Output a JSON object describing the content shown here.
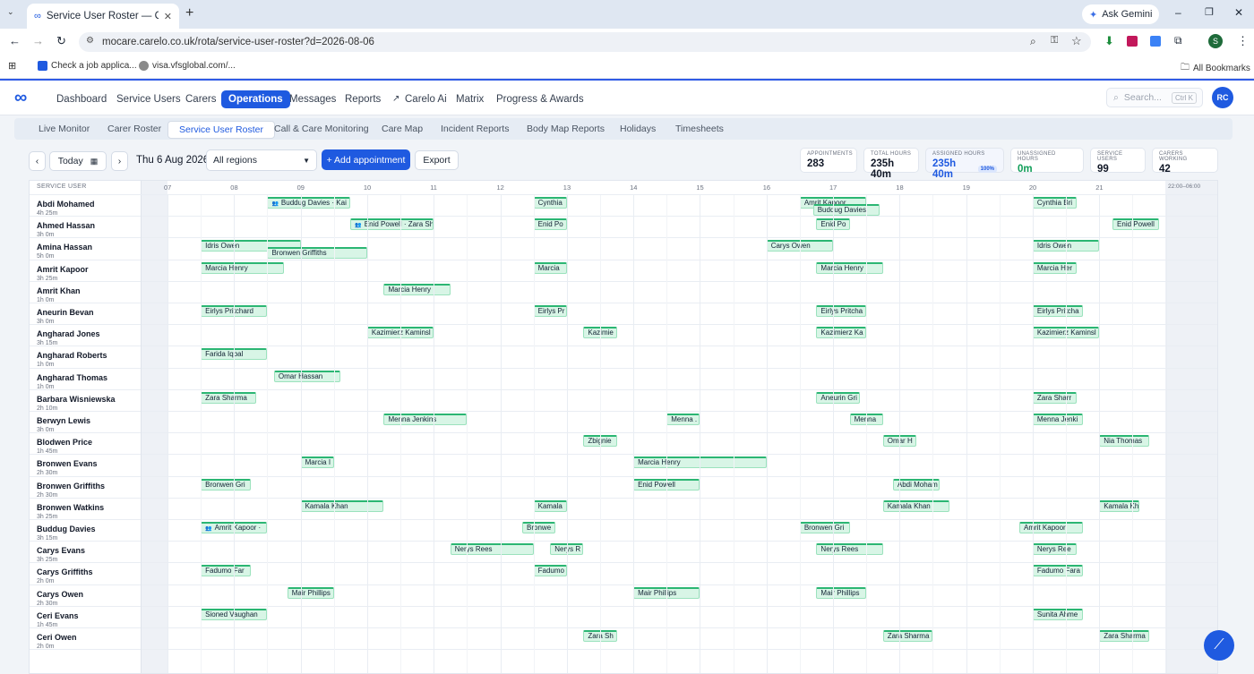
{
  "browser": {
    "tab_title": "Service User Roster — Carelo",
    "url": "mocare.carelo.co.uk/rota/service-user-roster?d=2026-08-06",
    "ask_gemini": "Ask Gemini",
    "profile_initial": "S",
    "bookmarks": [
      "Check a job applica...",
      "visa.vfsglobal.com/..."
    ],
    "all_bookmarks": "All Bookmarks"
  },
  "nav": {
    "items": [
      "Dashboard",
      "Service Users",
      "Carers",
      "Operations",
      "Messages",
      "Reports",
      "Carelo Ai",
      "Matrix",
      "Progress & Awards"
    ],
    "active": "Operations",
    "search_placeholder": "Search...",
    "search_shortcut": "Ctrl K",
    "avatar": "RC"
  },
  "subtabs": {
    "items": [
      "Live Monitor",
      "Carer Roster",
      "Service User Roster",
      "Call & Care Monitoring",
      "Care Map",
      "Incident Reports",
      "Body Map Reports",
      "Holidays",
      "Timesheets"
    ],
    "active": "Service User Roster"
  },
  "toolbar": {
    "today": "Today",
    "date": "Thu 6 Aug 2026",
    "region": "All regions",
    "add": "+ Add appointment",
    "export": "Export"
  },
  "stats": [
    {
      "k": "Appointments",
      "v": "283"
    },
    {
      "k": "Total hours",
      "v": "235h 40m"
    },
    {
      "k": "Assigned hours",
      "v": "235h 40m",
      "badge": "100%"
    },
    {
      "k": "Unassigned hours",
      "v": "0m"
    },
    {
      "k": "Service users",
      "v": "99"
    },
    {
      "k": "Carers working",
      "v": "42"
    }
  ],
  "grid": {
    "header": "SERVICE USER",
    "hours": [
      "07",
      "08",
      "09",
      "10",
      "11",
      "12",
      "13",
      "14",
      "15",
      "16",
      "17",
      "18",
      "19",
      "20",
      "21"
    ],
    "night": "22:00–06:00"
  },
  "rows": [
    {
      "name": "Abdi Mohamed",
      "dur": "4h 25m",
      "appts": [
        {
          "s": 8.5,
          "e": 9.75,
          "t": "Buddug Davies · Kai",
          "g": true
        },
        {
          "s": 12.5,
          "e": 13,
          "t": "Cynthia"
        },
        {
          "s": 16.5,
          "e": 17.5,
          "t": "Amrit Kapoor"
        },
        {
          "s": 16.7,
          "e": 17.7,
          "t": "Buddug Davies",
          "l": 2
        },
        {
          "s": 20,
          "e": 20.66,
          "t": "Cynthia Bri"
        }
      ]
    },
    {
      "name": "Ahmed Hassan",
      "dur": "3h 0m",
      "appts": [
        {
          "s": 9.75,
          "e": 11,
          "t": "Enid Powell · Zara Sh",
          "g": true
        },
        {
          "s": 12.5,
          "e": 13,
          "t": "Enid Po"
        },
        {
          "s": 16.75,
          "e": 17.25,
          "t": "Enid Po"
        },
        {
          "s": 21.2,
          "e": 21.9,
          "t": "Enid Powell"
        }
      ]
    },
    {
      "name": "Amina Hassan",
      "dur": "5h 0m",
      "appts": [
        {
          "s": 7.5,
          "e": 9,
          "t": "Idris Owen"
        },
        {
          "s": 8.5,
          "e": 10,
          "t": "Bronwen Griffiths",
          "l": 2
        },
        {
          "s": 16,
          "e": 17,
          "t": "Carys Owen"
        },
        {
          "s": 20,
          "e": 21,
          "t": "Idris Owen"
        }
      ]
    },
    {
      "name": "Amrit Kapoor",
      "dur": "3h 25m",
      "appts": [
        {
          "s": 7.5,
          "e": 8.75,
          "t": "Marcia Henry"
        },
        {
          "s": 12.5,
          "e": 13,
          "t": "Marcia"
        },
        {
          "s": 16.75,
          "e": 17.75,
          "t": "Marcia Henry"
        },
        {
          "s": 20,
          "e": 20.66,
          "t": "Marcia Her"
        }
      ]
    },
    {
      "name": "Amrit Khan",
      "dur": "1h 0m",
      "appts": [
        {
          "s": 10.25,
          "e": 11.25,
          "t": "Marcia Henry"
        }
      ]
    },
    {
      "name": "Aneurin Bevan",
      "dur": "3h 0m",
      "appts": [
        {
          "s": 7.5,
          "e": 8.5,
          "t": "Eirlys Pritchard"
        },
        {
          "s": 12.5,
          "e": 13,
          "t": "Eirlys Pr"
        },
        {
          "s": 16.75,
          "e": 17.5,
          "t": "Eirlys Pritcha"
        },
        {
          "s": 20,
          "e": 20.75,
          "t": "Eirlys Pritcha"
        }
      ]
    },
    {
      "name": "Angharad Jones",
      "dur": "3h 15m",
      "appts": [
        {
          "s": 10,
          "e": 11,
          "t": "Kazimierz Kaminsl"
        },
        {
          "s": 13.25,
          "e": 13.75,
          "t": "Kazimie"
        },
        {
          "s": 16.75,
          "e": 17.5,
          "t": "Kazimierz Ka"
        },
        {
          "s": 20,
          "e": 21,
          "t": "Kazimierz Kaminsl"
        }
      ]
    },
    {
      "name": "Angharad Roberts",
      "dur": "1h 0m",
      "appts": [
        {
          "s": 7.5,
          "e": 8.5,
          "t": "Farida Iqbal"
        }
      ]
    },
    {
      "name": "Angharad Thomas",
      "dur": "1h 0m",
      "appts": [
        {
          "s": 8.6,
          "e": 9.6,
          "t": "Omar Hassan"
        }
      ]
    },
    {
      "name": "Barbara Wisniewska",
      "dur": "2h 10m",
      "appts": [
        {
          "s": 7.5,
          "e": 8.33,
          "t": "Zara Sharma"
        },
        {
          "s": 16.75,
          "e": 17.4,
          "t": "Aneurin Gri"
        },
        {
          "s": 20,
          "e": 20.66,
          "t": "Zara Sharr"
        }
      ]
    },
    {
      "name": "Berwyn Lewis",
      "dur": "3h 0m",
      "appts": [
        {
          "s": 10.25,
          "e": 11.5,
          "t": "Menna Jenkins"
        },
        {
          "s": 14.5,
          "e": 15,
          "t": "Menna ."
        },
        {
          "s": 17.25,
          "e": 17.75,
          "t": "Menna"
        },
        {
          "s": 20,
          "e": 20.75,
          "t": "Menna Jenki"
        }
      ]
    },
    {
      "name": "Blodwen Price",
      "dur": "1h 45m",
      "appts": [
        {
          "s": 13.25,
          "e": 13.75,
          "t": "Zbignie"
        },
        {
          "s": 17.75,
          "e": 18.25,
          "t": "Omar H"
        },
        {
          "s": 21,
          "e": 21.75,
          "t": "Nia Thomas"
        }
      ]
    },
    {
      "name": "Bronwen Evans",
      "dur": "2h 30m",
      "appts": [
        {
          "s": 9,
          "e": 9.5,
          "t": "Marcia I"
        },
        {
          "s": 14,
          "e": 16,
          "t": "Marcia Henry"
        }
      ]
    },
    {
      "name": "Bronwen Griffiths",
      "dur": "2h 30m",
      "appts": [
        {
          "s": 7.5,
          "e": 8.25,
          "t": "Bronwen Gri"
        },
        {
          "s": 14,
          "e": 15,
          "t": "Enid Powell"
        },
        {
          "s": 17.9,
          "e": 18.6,
          "t": "Abdi Moham"
        }
      ]
    },
    {
      "name": "Bronwen Watkins",
      "dur": "3h 25m",
      "appts": [
        {
          "s": 9,
          "e": 10.25,
          "t": "Kamala Khan"
        },
        {
          "s": 12.5,
          "e": 13,
          "t": "Kamala"
        },
        {
          "s": 17.75,
          "e": 18.75,
          "t": "Kamala Khan"
        },
        {
          "s": 21,
          "e": 21.6,
          "t": "Kamala Kh"
        }
      ]
    },
    {
      "name": "Buddug Davies",
      "dur": "3h 15m",
      "appts": [
        {
          "s": 7.5,
          "e": 8.5,
          "t": "Amrit Kapoor ·",
          "g": true
        },
        {
          "s": 12.33,
          "e": 12.83,
          "t": "Bronwe"
        },
        {
          "s": 16.5,
          "e": 17.25,
          "t": "Bronwen Gri"
        },
        {
          "s": 19.8,
          "e": 20.75,
          "t": "Amrit Kapoor"
        }
      ]
    },
    {
      "name": "Carys Evans",
      "dur": "3h 25m",
      "appts": [
        {
          "s": 11.25,
          "e": 12.5,
          "t": "Nerys Rees"
        },
        {
          "s": 12.75,
          "e": 13.25,
          "t": "Nerys R"
        },
        {
          "s": 16.75,
          "e": 17.75,
          "t": "Nerys Rees"
        },
        {
          "s": 20,
          "e": 20.66,
          "t": "Nerys Ree"
        }
      ]
    },
    {
      "name": "Carys Griffiths",
      "dur": "2h 0m",
      "appts": [
        {
          "s": 7.5,
          "e": 8.25,
          "t": "Fadumo Far"
        },
        {
          "s": 12.5,
          "e": 13,
          "t": "Fadumo"
        },
        {
          "s": 20,
          "e": 20.75,
          "t": "Fadumo Fara"
        }
      ]
    },
    {
      "name": "Carys Owen",
      "dur": "2h 30m",
      "appts": [
        {
          "s": 8.8,
          "e": 9.5,
          "t": "Mair Phillips"
        },
        {
          "s": 14,
          "e": 15,
          "t": "Mair Phillips"
        },
        {
          "s": 16.75,
          "e": 17.5,
          "t": "Mair Phillips"
        }
      ]
    },
    {
      "name": "Ceri Evans",
      "dur": "1h 45m",
      "appts": [
        {
          "s": 7.5,
          "e": 8.5,
          "t": "Sioned Vaughan"
        },
        {
          "s": 20,
          "e": 20.75,
          "t": "Sunita Ahme"
        }
      ]
    },
    {
      "name": "Ceri Owen",
      "dur": "2h 0m",
      "appts": [
        {
          "s": 13.25,
          "e": 13.75,
          "t": "Zara Sh"
        },
        {
          "s": 17.75,
          "e": 18.5,
          "t": "Zara Sharma"
        },
        {
          "s": 21,
          "e": 21.75,
          "t": "Zara Sharma"
        }
      ]
    }
  ]
}
